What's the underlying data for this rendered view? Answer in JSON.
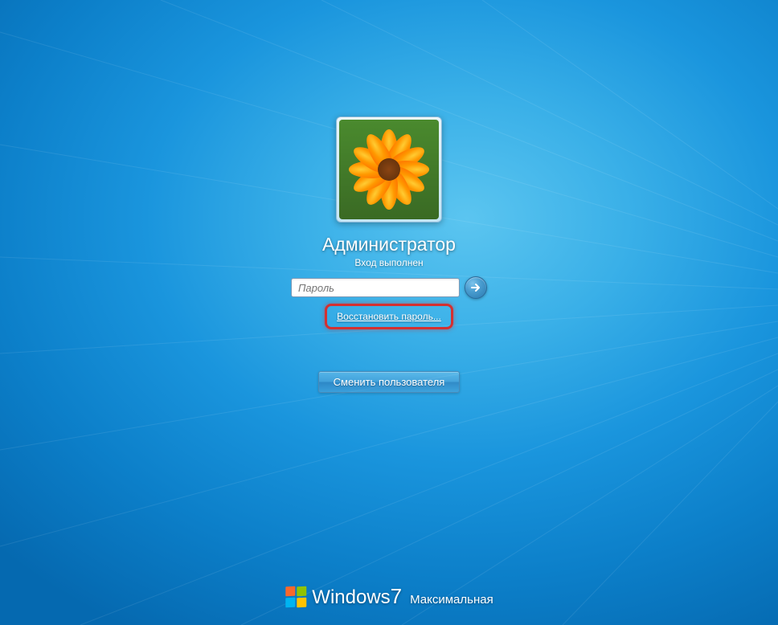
{
  "user": {
    "name": "Администратор",
    "status": "Вход выполнен"
  },
  "password": {
    "placeholder": "Пароль"
  },
  "links": {
    "reset_password": "Восстановить пароль..."
  },
  "buttons": {
    "switch_user": "Сменить пользователя"
  },
  "branding": {
    "os": "Windows",
    "version": "7",
    "edition": "Максимальная"
  }
}
